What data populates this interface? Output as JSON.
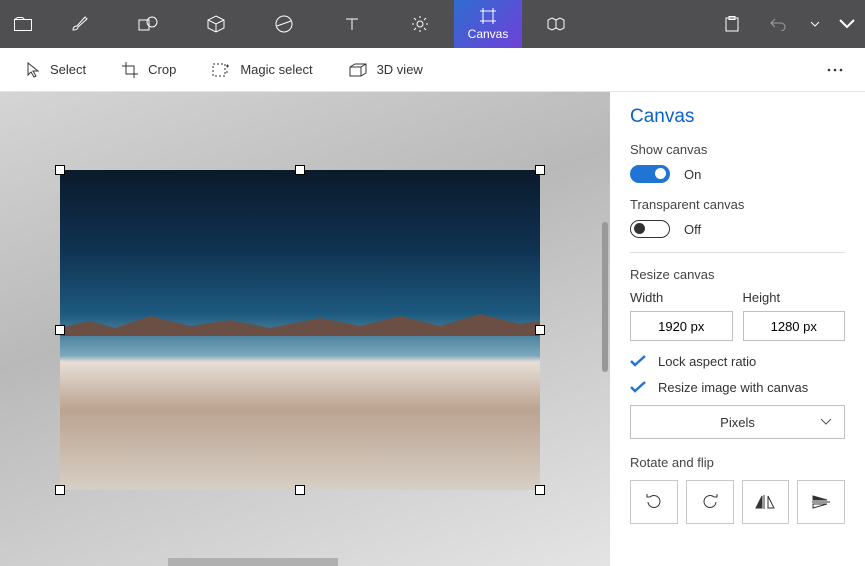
{
  "ribbon": {
    "canvas_label": "Canvas"
  },
  "toolbar": {
    "select": "Select",
    "crop": "Crop",
    "magic_select": "Magic select",
    "view3d": "3D view"
  },
  "panel": {
    "title": "Canvas",
    "show_canvas_label": "Show canvas",
    "show_canvas_state": "On",
    "transparent_label": "Transparent canvas",
    "transparent_state": "Off",
    "resize_label": "Resize canvas",
    "width_label": "Width",
    "height_label": "Height",
    "width_value": "1920 px",
    "height_value": "1280 px",
    "lock_aspect": "Lock aspect ratio",
    "resize_image": "Resize image with canvas",
    "units": "Pixels",
    "rotate_flip": "Rotate and flip"
  }
}
